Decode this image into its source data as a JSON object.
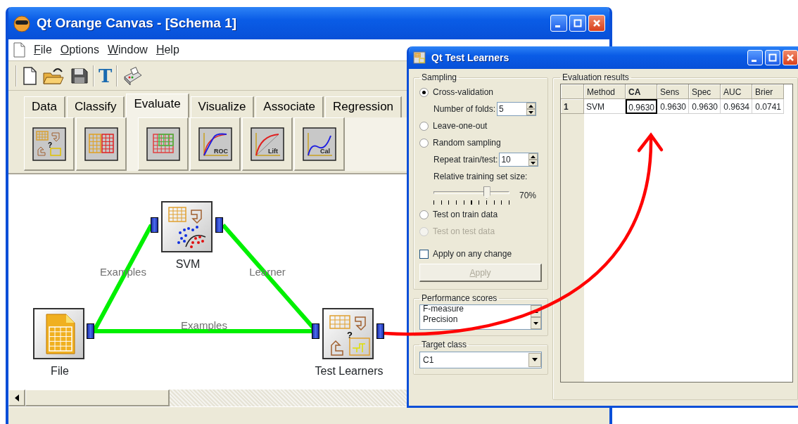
{
  "main_window": {
    "title": "Qt Orange Canvas - [Schema 1]",
    "menu": [
      {
        "label": "File"
      },
      {
        "label": "Options"
      },
      {
        "label": "Window"
      },
      {
        "label": "Help"
      }
    ],
    "toolbar": {
      "text_tool": "T"
    },
    "widget_tabs": [
      {
        "label": "Data",
        "selected": false
      },
      {
        "label": "Classify",
        "selected": false
      },
      {
        "label": "Evaluate",
        "selected": true
      },
      {
        "label": "Visualize",
        "selected": false
      },
      {
        "label": "Associate",
        "selected": false
      },
      {
        "label": "Regression",
        "selected": false
      }
    ],
    "widget_buttons": [
      {
        "kind": "test",
        "glyph": "?"
      },
      {
        "kind": "confusion"
      },
      {
        "kind": "table"
      },
      {
        "kind": "roc",
        "caption": "ROC"
      },
      {
        "kind": "lift",
        "caption": "Lift"
      },
      {
        "kind": "calibration",
        "caption": "Cal"
      }
    ],
    "canvas": {
      "nodes": [
        {
          "kind": "file",
          "label": "File"
        },
        {
          "kind": "svm",
          "label": "SVM"
        },
        {
          "kind": "test",
          "label": "Test Learners",
          "glyph": "?"
        }
      ],
      "links": [
        {
          "label": "Examples"
        },
        {
          "label": "Learner"
        },
        {
          "label": "Examples"
        }
      ]
    }
  },
  "dialog": {
    "title": "Qt Test Learners",
    "sampling": {
      "title": "Sampling",
      "items": [
        {
          "kind": "radio",
          "label": "Cross-validation",
          "selected": true,
          "disabled": false
        },
        {
          "kind": "spin",
          "label": "Number of folds:",
          "value": "5"
        },
        {
          "kind": "radio",
          "label": "Leave-one-out",
          "selected": false,
          "disabled": false
        },
        {
          "kind": "radio",
          "label": "Random sampling",
          "selected": false,
          "disabled": false
        },
        {
          "kind": "spin",
          "label": "Repeat train/test:",
          "value": "10"
        },
        {
          "kind": "text",
          "label": "Relative training set size:"
        },
        {
          "kind": "slider",
          "level": 0.7,
          "reading": "70%"
        },
        {
          "kind": "radio",
          "label": "Test on train data",
          "selected": false,
          "disabled": false
        },
        {
          "kind": "radio",
          "label": "Test on test data",
          "selected": false,
          "disabled": true
        },
        {
          "kind": "checkbox",
          "label": "Apply on any change",
          "checked": false
        },
        {
          "kind": "button",
          "label": "Apply",
          "disabled": true
        }
      ]
    },
    "performance_scores": {
      "title": "Performance scores",
      "items": [
        "F-measure",
        "Precision"
      ]
    },
    "target_class": {
      "title": "Target class",
      "value": "C1"
    },
    "evaluation_results": {
      "title": "Evaluation results",
      "columns": [
        {
          "label": "Method",
          "selected": false
        },
        {
          "label": "CA",
          "selected": true
        },
        {
          "label": "Sens",
          "selected": false
        },
        {
          "label": "Spec",
          "selected": false
        },
        {
          "label": "AUC",
          "selected": false
        },
        {
          "label": "Brier",
          "selected": false
        }
      ],
      "rows": [
        {
          "header": "1",
          "cells": [
            "SVM",
            "0.9630",
            "0.9630",
            "0.9630",
            "0.9634",
            "0.0741"
          ]
        }
      ]
    }
  }
}
